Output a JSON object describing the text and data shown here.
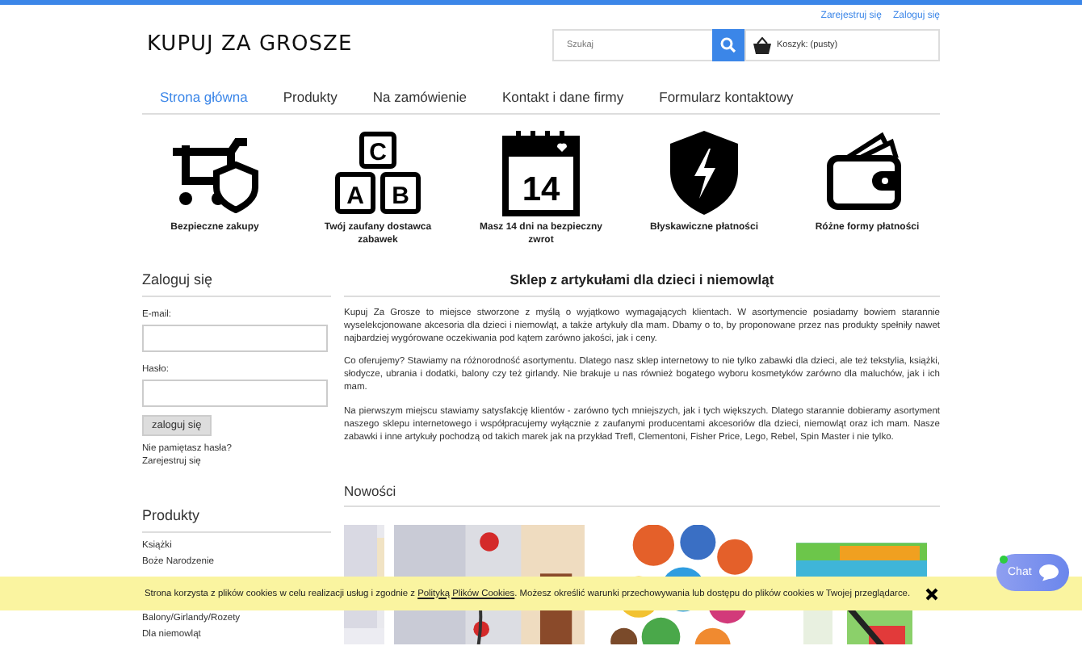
{
  "header": {
    "links": [
      "Zarejestruj się",
      "Zaloguj się"
    ],
    "logo": "KUPUJ ZA GROSZE",
    "search": {
      "placeholder": "Szukaj"
    },
    "cart": "Koszyk: (pusty)"
  },
  "nav": [
    {
      "label": "Strona główna",
      "selected": true
    },
    {
      "label": "Produkty",
      "selected": false
    },
    {
      "label": "Na zamówienie",
      "selected": false
    },
    {
      "label": "Kontakt i dane firmy",
      "selected": false
    },
    {
      "label": "Formularz kontaktowy",
      "selected": false
    }
  ],
  "features": [
    {
      "kind": "cart-shield",
      "label": "Bezpieczne zakupy"
    },
    {
      "kind": "blocks",
      "label": "Twój zaufany dostawca zabawek",
      "letters": [
        "C",
        "A",
        "B"
      ]
    },
    {
      "kind": "calendar",
      "label": "Masz 14 dni na bezpieczny zwrot",
      "day": "14"
    },
    {
      "kind": "shield-bolt",
      "label": "Błyskawiczne płatności"
    },
    {
      "kind": "wallet",
      "label": "Różne formy płatności"
    }
  ],
  "login": {
    "title": "Zaloguj się",
    "email_label": "E-mail:",
    "password_label": "Hasło:",
    "button": "zaloguj się",
    "forgot": "Nie pamiętasz hasła?",
    "register": "Zarejestruj się"
  },
  "products": {
    "title": "Produkty",
    "items": [
      "Książki",
      "Boże Narodzenie",
      "Balony/Girlandy/Rozety",
      "Dla niemowląt"
    ]
  },
  "main": {
    "title": "Sklep z artykułami dla dzieci i niemowląt",
    "paragraphs": [
      "Kupuj Za Grosze to miejsce stworzone z myślą o wyjątkowo wymagających klientach. W asortymencie posiadamy bowiem starannie wyselekcjonowane akcesoria dla dzieci i niemowląt, a także artykuły dla mam. Dbamy o to, by proponowane przez nas produkty spełniły nawet najbardziej wygórowane oczekiwania pod kątem zarówno jakości, jak i ceny.",
      "Co oferujemy? Stawiamy na różnorodność asortymentu. Dlatego nasz sklep internetowy to nie tylko zabawki dla dzieci, ale też tekstylia, książki, słodycze, ubrania i dodatki, balony czy też girlandy. Nie brakuje u nas również bogatego wyboru kosmetyków zarówno dla maluchów, jak i ich mam.",
      "Na pierwszym miejscu stawiamy satysfakcję klientów - zarówno tych mniejszych, jak i tych większych. Dlatego starannie dobieramy asortyment naszego sklepu internetowego i współpracujemy wyłącznie z zaufanymi producentami akcesoriów dla dzieci, niemowląt oraz ich mam. Nasze zabawki i inne artykuły pochodzą od takich marek jak na przykład Trefl, Clementoni, Fisher Price, Lego, Rebel, Spin Master i nie tylko."
    ]
  },
  "news": {
    "title": "Nowości"
  },
  "cookie": {
    "text_before": "Strona korzysta z plików cookies w celu realizacji usług i zgodnie z ",
    "link": "Polityką Plików Cookies",
    "text_after": ". Możesz określić warunki przechowywania lub dostępu do plików cookies w Twojej przeglądarce."
  },
  "chat": {
    "label": "Chat",
    "online": true
  }
}
